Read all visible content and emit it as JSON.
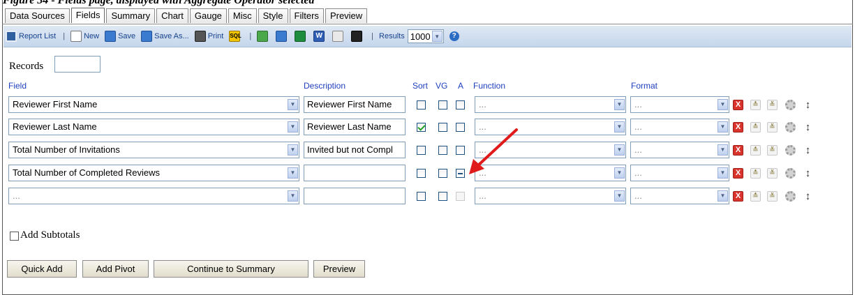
{
  "caption": "Figure 34 - Fields page, displayed with Aggregate Operator selected",
  "tabs": [
    "Data Sources",
    "Fields",
    "Summary",
    "Chart",
    "Gauge",
    "Misc",
    "Style",
    "Filters",
    "Preview"
  ],
  "active_tab": "Fields",
  "toolbar": {
    "report_list": "Report List",
    "new": "New",
    "save": "Save",
    "save_as": "Save As...",
    "print": "Print",
    "sql_icon_text": "SQL",
    "word_icon_text": "W",
    "results_label": "Results",
    "results_value": "1000",
    "help_icon_text": "?"
  },
  "records": {
    "label": "Records",
    "value": ""
  },
  "headers": {
    "field": "Field",
    "description": "Description",
    "sort": "Sort",
    "vg": "VG",
    "a": "A",
    "function": "Function",
    "format": "Format"
  },
  "rows": [
    {
      "field": "Reviewer First Name",
      "description": "Reviewer First Name",
      "sort": false,
      "vg": false,
      "a": "unchecked",
      "function": "...",
      "format": "..."
    },
    {
      "field": "Reviewer Last Name",
      "description": "Reviewer Last Name",
      "sort": true,
      "vg": false,
      "a": "unchecked",
      "function": "...",
      "format": "..."
    },
    {
      "field": "Total Number of Invitations",
      "description": "Invited but not Compl",
      "sort": false,
      "vg": false,
      "a": "unchecked",
      "function": "...",
      "format": "..."
    },
    {
      "field": "Total Number of Completed Reviews",
      "description": "",
      "sort": false,
      "vg": false,
      "a": "indeterminate",
      "function": "...",
      "format": "..."
    },
    {
      "field": "...",
      "description": "",
      "sort": false,
      "vg": false,
      "a": "disabled",
      "function": "...",
      "format": "..."
    }
  ],
  "row_actions": {
    "delete": "X",
    "move_up": "≛",
    "move_down": "≚",
    "settings": "",
    "reorder": "↕"
  },
  "add_subtotals": {
    "label": "Add Subtotals",
    "checked": false
  },
  "buttons": {
    "quick_add": "Quick Add",
    "add_pivot": "Add Pivot",
    "continue": "Continue to Summary",
    "preview": "Preview"
  },
  "colors": {
    "arrow": "#e01b1b",
    "header_text": "#1f3fbf",
    "toolbar_text": "#15428b"
  }
}
